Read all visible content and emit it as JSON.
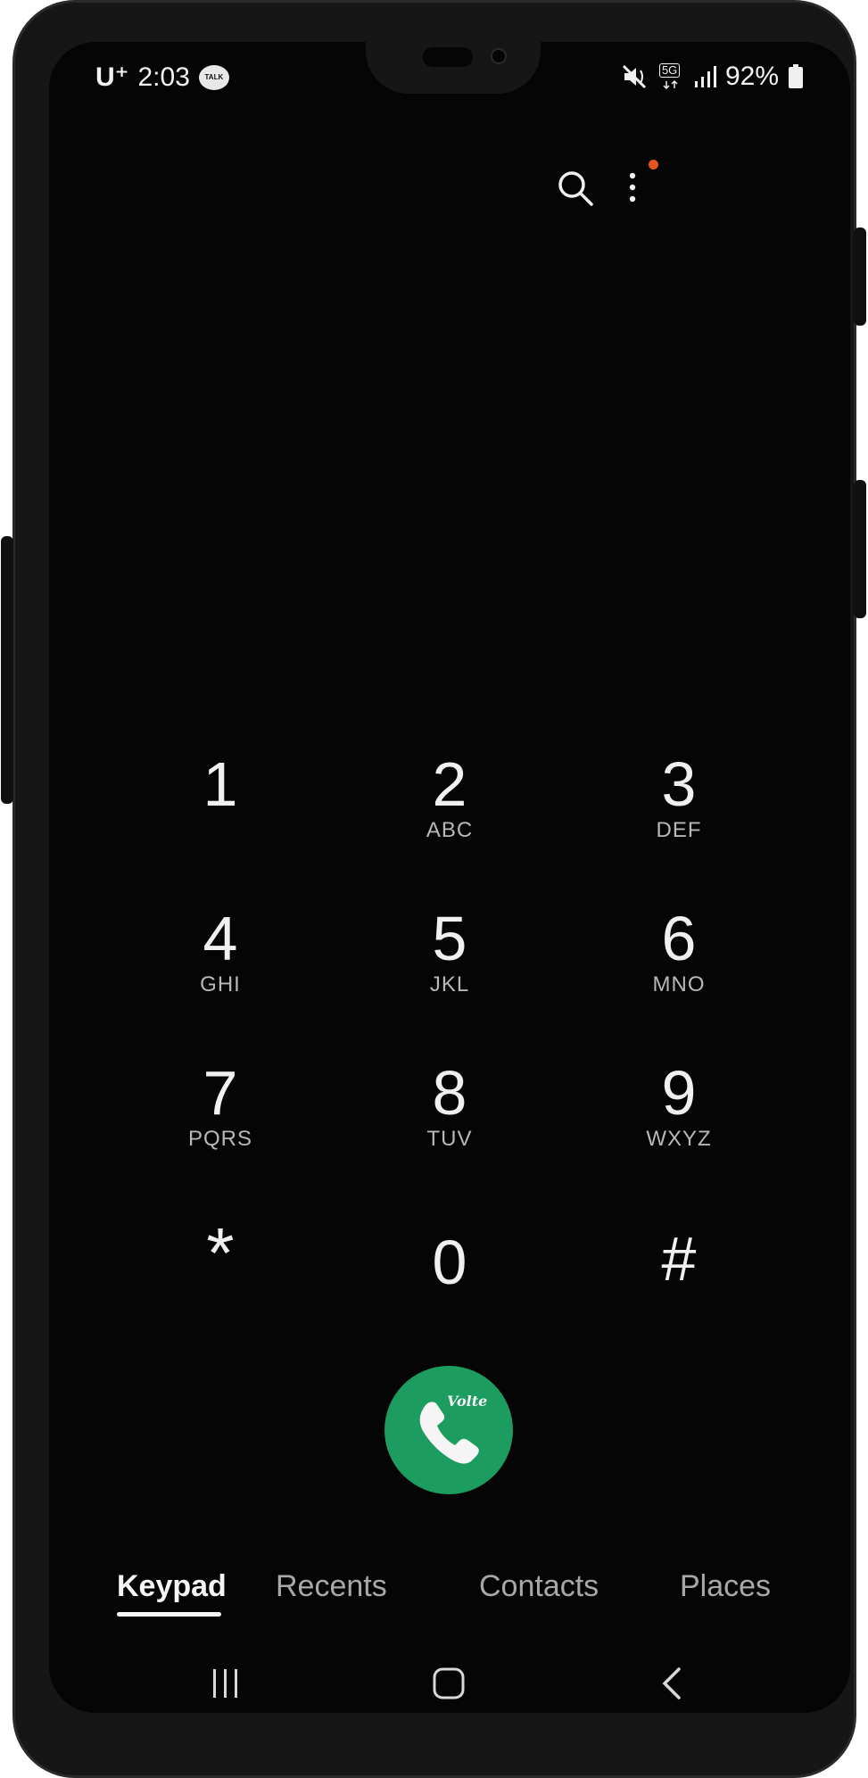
{
  "status_bar": {
    "carrier": "U⁺",
    "time": "2:03",
    "talk_badge": "TALK",
    "network": "5G",
    "battery": "92%"
  },
  "top_actions": {
    "search_icon": "search-icon",
    "more_icon": "more-options-icon",
    "notification_dot_color": "#e5561f"
  },
  "keypad": [
    {
      "digit": "1",
      "letters": ""
    },
    {
      "digit": "2",
      "letters": "ABC"
    },
    {
      "digit": "3",
      "letters": "DEF"
    },
    {
      "digit": "4",
      "letters": "GHI"
    },
    {
      "digit": "5",
      "letters": "JKL"
    },
    {
      "digit": "6",
      "letters": "MNO"
    },
    {
      "digit": "7",
      "letters": "PQRS"
    },
    {
      "digit": "8",
      "letters": "TUV"
    },
    {
      "digit": "9",
      "letters": "WXYZ"
    },
    {
      "digit": "*",
      "letters": ""
    },
    {
      "digit": "0",
      "letters": ""
    },
    {
      "digit": "#",
      "letters": ""
    }
  ],
  "call_button": {
    "badge": "Volte",
    "color": "#1d9c5f"
  },
  "tabs": [
    {
      "label": "Keypad",
      "active": true
    },
    {
      "label": "Recents",
      "active": false
    },
    {
      "label": "Contacts",
      "active": false
    },
    {
      "label": "Places",
      "active": false
    }
  ],
  "nav_bar": {
    "recents_icon": "recent-apps-icon",
    "home_icon": "home-icon",
    "back_icon": "back-icon"
  }
}
